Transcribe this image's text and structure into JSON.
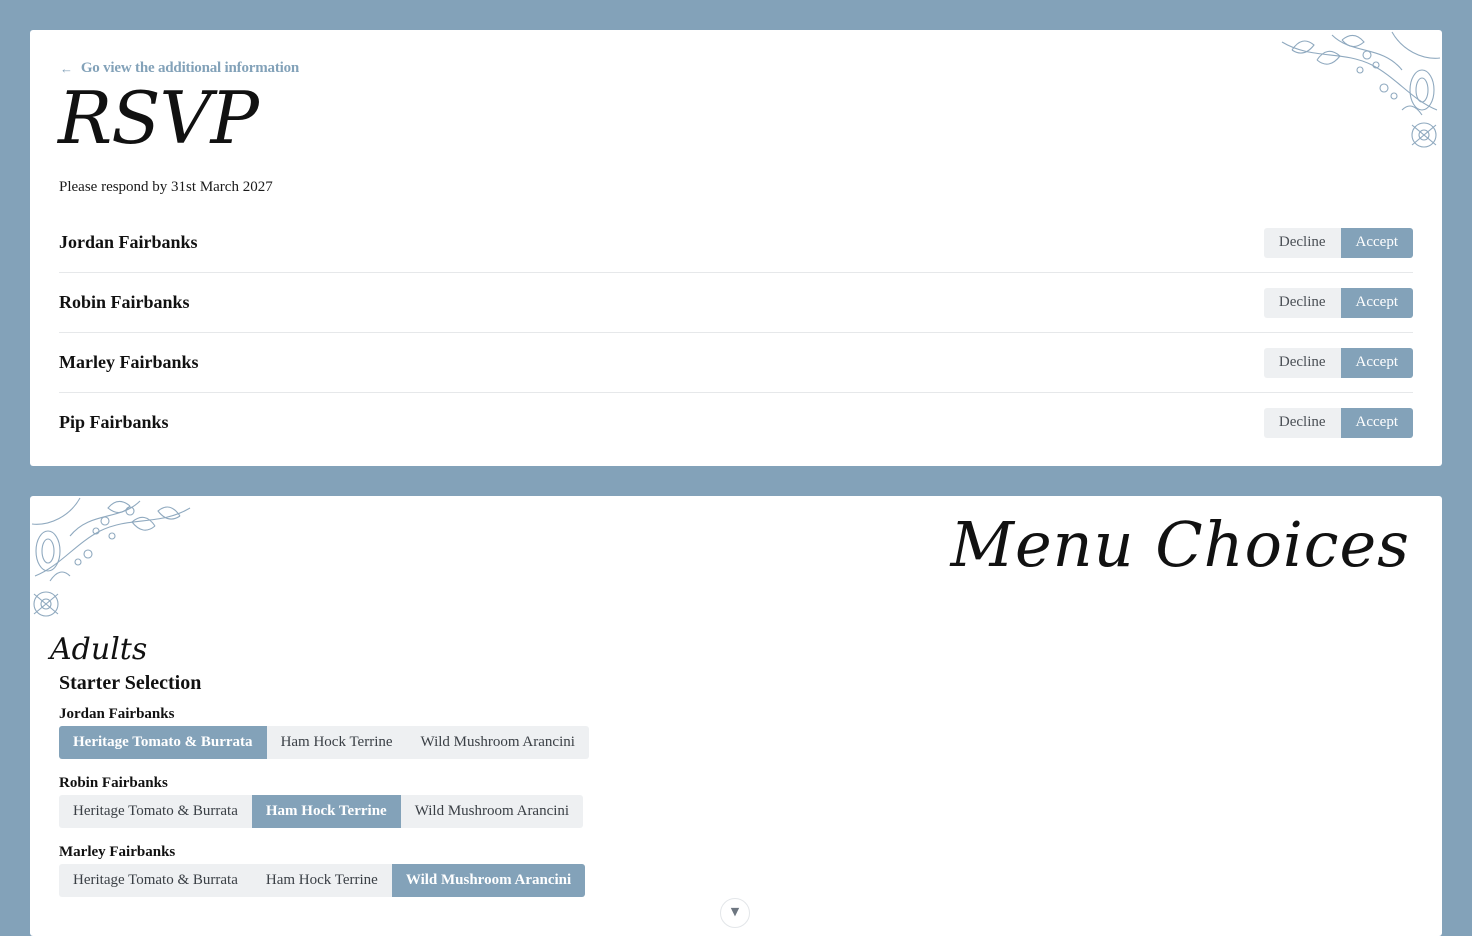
{
  "rsvp": {
    "back_link": "Go view the additional information",
    "title": "RSVP",
    "respond_by": "Please respond by 31st March 2027",
    "decline_label": "Decline",
    "accept_label": "Accept",
    "guests": [
      {
        "name": "Jordan Fairbanks",
        "status": "accepted"
      },
      {
        "name": "Robin Fairbanks",
        "status": "accepted"
      },
      {
        "name": "Marley Fairbanks",
        "status": "accepted"
      },
      {
        "name": "Pip Fairbanks",
        "status": "accepted"
      }
    ]
  },
  "menu": {
    "title": "Menu Choices",
    "group_label": "Adults",
    "starter_heading": "Starter Selection",
    "starter_options": [
      "Heritage Tomato & Burrata",
      "Ham Hock Terrine",
      "Wild Mushroom Arancini"
    ],
    "starters": [
      {
        "guest": "Jordan Fairbanks",
        "selected": "Heritage Tomato & Burrata"
      },
      {
        "guest": "Robin Fairbanks",
        "selected": "Ham Hock Terrine"
      },
      {
        "guest": "Marley Fairbanks",
        "selected": "Wild Mushroom Arancini"
      }
    ]
  },
  "colors": {
    "accent": "#83a2b9",
    "background": "#83a2b9",
    "card": "#ffffff",
    "unselected": "#eef0f2"
  },
  "icons": {
    "back": "arrow-left-icon",
    "scroll": "chevron-down-icon",
    "decoration": "floral-corner"
  }
}
